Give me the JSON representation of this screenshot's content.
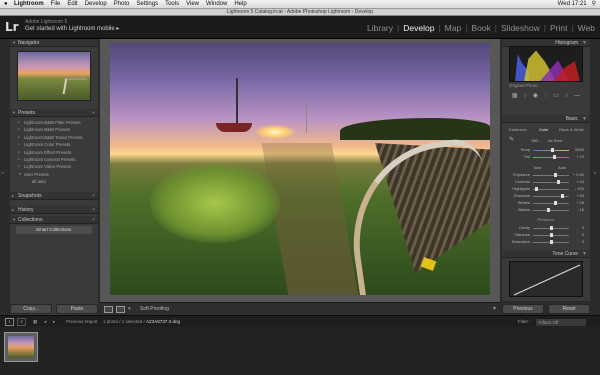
{
  "menubar": {
    "apple": "",
    "items": [
      "Lightroom",
      "File",
      "Edit",
      "Develop",
      "Photo",
      "Settings",
      "Tools",
      "View",
      "Window",
      "Help"
    ],
    "right_time": "Wed 17:21"
  },
  "window_title": "Lightroom 5 Catalog.lrcat - Adobe Photoshop Lightroom - Develop",
  "identity": {
    "logo": "Lr",
    "line1": "Adobe Lightroom 5",
    "line2": "Get started with Lightroom mobile",
    "arrow": "▸"
  },
  "modules": [
    "Library",
    "Develop",
    "Map",
    "Book",
    "Slideshow",
    "Print",
    "Web"
  ],
  "active_module": "Develop",
  "left_panel": {
    "navigator": "Navigator",
    "presets": "Presets",
    "preset_items": [
      "Lightroom B&W Filter Presets",
      "Lightroom B&W Presets",
      "Lightroom B&W Toned Presets",
      "Lightroom Color Presets",
      "Lightroom Effect Presets",
      "Lightroom General Presets",
      "Lightroom Video Presets",
      "User Presets"
    ],
    "preset_sub": "all auto",
    "snapshots": "Snapshots",
    "history": "History",
    "collections": "Collections",
    "smart_collections": "Smart Collections",
    "copy_button": "Copy...",
    "paste_button": "Paste"
  },
  "toolbar": {
    "soft_proofing": "Soft Proofing"
  },
  "right_panel": {
    "histogram": "Histogram",
    "original_photo": "Original Photo",
    "basic": "Basic",
    "treatment": [
      "Treatment :",
      "Color",
      "Black & White"
    ],
    "wb": "WB :",
    "wb_value": "As Shot",
    "temp": {
      "label": "Temp",
      "value": "5500"
    },
    "tint": {
      "label": "Tint",
      "value": "+ 10"
    },
    "tone": "Tone",
    "auto": "Auto",
    "sliders": [
      {
        "label": "Exposure",
        "value": "+ 0.60",
        "pos": 0.62
      },
      {
        "label": "Contrast",
        "value": "+ 43",
        "pos": 0.7
      },
      {
        "label": "Highlights",
        "value": "- 100",
        "pos": 0.05
      },
      {
        "label": "Shadows",
        "value": "+ 63",
        "pos": 0.82
      },
      {
        "label": "Whites",
        "value": "+ 26",
        "pos": 0.63
      },
      {
        "label": "Blacks",
        "value": "- 16",
        "pos": 0.42
      }
    ],
    "presence": "Presence",
    "presence_sliders": [
      {
        "label": "Clarity",
        "value": "0",
        "pos": 0.5
      },
      {
        "label": "Vibrance",
        "value": "0",
        "pos": 0.5
      },
      {
        "label": "Saturation",
        "value": "0",
        "pos": 0.5
      }
    ],
    "tone_curve": "Tone Curve",
    "previous_button": "Previous",
    "reset_button": "Reset"
  },
  "filmbar": {
    "page_1": "1",
    "page_2": "2",
    "source": "Previous Import",
    "count": "1 photo / 1 selected /",
    "filename": "AZ3A8737-2.dng",
    "filter_label": "Filter :",
    "filter_value": "Filters Off"
  },
  "colors": {
    "accent": "#f0f0f0",
    "panel": "#3a3a3a",
    "background": "#2b2b2b"
  },
  "icons": [
    "apple-icon",
    "disclosure-triangle-icon",
    "plus-icon",
    "loupe-view-icon",
    "before-after-icon",
    "crop-icon",
    "spot-removal-icon",
    "red-eye-icon",
    "graduated-filter-icon",
    "radial-filter-icon",
    "adjustment-brush-icon",
    "eyedropper-icon",
    "grid-icon",
    "back-icon",
    "forward-icon"
  ]
}
